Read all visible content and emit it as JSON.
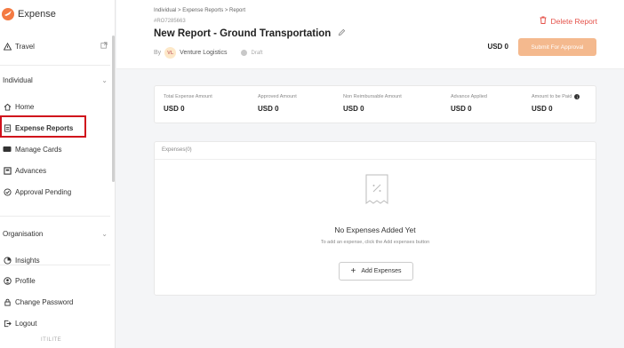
{
  "brand": {
    "name": "Expense",
    "accent": "#f47a42"
  },
  "sidebar": {
    "travel": {
      "label": "Travel",
      "icon": "warning-triangle-icon",
      "end_icon": "external-link-icon"
    },
    "sections": [
      {
        "title": "Individual",
        "icon": "chevron-down-icon"
      },
      {
        "title": "Organisation",
        "icon": "chevron-down-icon"
      }
    ],
    "individual_items": [
      {
        "label": "Home",
        "icon": "home-icon"
      },
      {
        "label": "Expense Reports",
        "icon": "report-icon",
        "active": true
      },
      {
        "label": "Manage Cards",
        "icon": "card-icon"
      },
      {
        "label": "Advances",
        "icon": "advances-icon"
      },
      {
        "label": "Approval Pending",
        "icon": "check-circle-icon"
      }
    ],
    "org_items": [
      {
        "label": "Insights",
        "icon": "insights-icon"
      }
    ],
    "bottom_items": [
      {
        "label": "Profile",
        "icon": "profile-icon"
      },
      {
        "label": "Change Password",
        "icon": "lock-icon"
      },
      {
        "label": "Logout",
        "icon": "logout-icon"
      }
    ],
    "footer": "ITILITE"
  },
  "header": {
    "breadcrumb": "Individual > Expense Reports > Report",
    "report_id": "#RO7285663",
    "title": "New Report - Ground Transportation",
    "by_label": "By",
    "avatar_initials": "VL",
    "company": "Venture Logistics",
    "status": "Draft",
    "delete_label": "Delete Report",
    "total": "USD 0",
    "submit_label": "Submit For Approval",
    "danger_color": "#e5534b",
    "submit_color": "#f4b98e"
  },
  "summary": [
    {
      "label": "Total Expense Amount",
      "value": "USD 0"
    },
    {
      "label": "Approved Amount",
      "value": "USD 0"
    },
    {
      "label": "Non Reimbursable Amount",
      "value": "USD 0"
    },
    {
      "label": "Advance Applied",
      "value": "USD 0"
    },
    {
      "label": "Amount to be Paid",
      "value": "USD 0"
    }
  ],
  "expenses": {
    "header": "Expenses(0)",
    "empty_title": "No Expenses Added Yet",
    "empty_sub": "To add an expense, click the Add expenses button",
    "add_label": "Add Expenses",
    "add_icon": "plus-icon"
  }
}
